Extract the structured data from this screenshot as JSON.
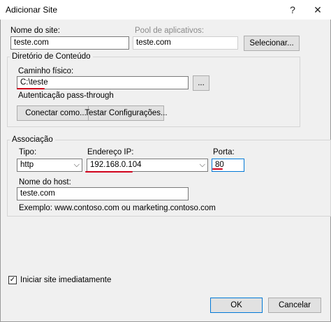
{
  "dialog": {
    "title": "Adicionar Site",
    "help_label": "?",
    "close_label": "✕"
  },
  "site_name": {
    "label": "Nome do site:",
    "value": "teste.com"
  },
  "app_pool": {
    "label": "Pool de aplicativos:",
    "value": "teste.com",
    "select_button": "Selecionar..."
  },
  "content_dir": {
    "legend": "Diretório de Conteúdo",
    "physical_path_label": "Caminho físico:",
    "physical_path_value": "C:\\teste",
    "browse_button": "...",
    "pass_through_label": "Autenticação pass-through",
    "connect_as_button": "Conectar como...",
    "test_settings_button": "Testar Configurações..."
  },
  "binding": {
    "legend": "Associação",
    "type_label": "Tipo:",
    "type_value": "http",
    "ip_label": "Endereço IP:",
    "ip_value": "192.168.0.104",
    "port_label": "Porta:",
    "port_value": "80",
    "host_label": "Nome do host:",
    "host_value": "teste.com",
    "example_text": "Exemplo: www.contoso.com ou marketing.contoso.com"
  },
  "start_immediately": {
    "label": "Iniciar site imediatamente",
    "checked": true
  },
  "footer": {
    "ok_label": "OK",
    "cancel_label": "Cancelar"
  },
  "annotation_color": "#d0021b"
}
